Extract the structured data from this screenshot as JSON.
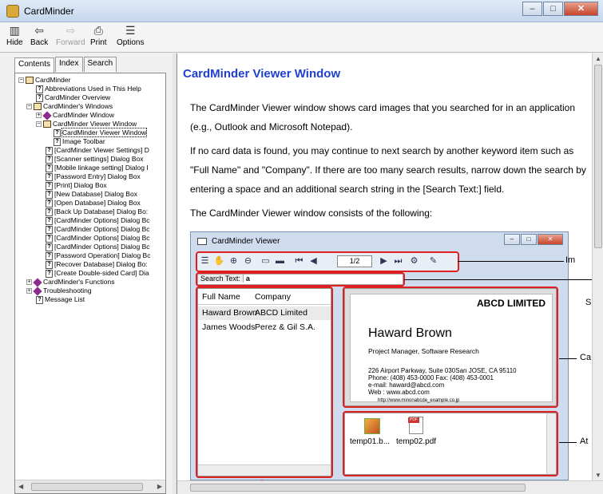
{
  "window": {
    "title": "CardMinder",
    "min": "–",
    "max": "□",
    "close": "✕"
  },
  "toolbar": {
    "hide": "Hide",
    "back": "Back",
    "forward": "Forward",
    "print": "Print",
    "options": "Options"
  },
  "tabs": [
    "Contents",
    "Index",
    "Search"
  ],
  "tree": {
    "items": [
      "CardMinder",
      "Abbreviations Used in This Help",
      "CardMinder Overview",
      "CardMinder's Windows",
      "CardMinder Window",
      "CardMinder Viewer Window",
      "CardMinder Viewer Window",
      "Image Toolbar",
      "[CardMinder Viewer Settings] D",
      "[Scanner settings] Dialog Box",
      "[Mobile linkage setting] Dialog I",
      "[Password Entry] Dialog Box",
      "[Print] Dialog Box",
      "[New Database] Dialog Box",
      "[Open Database] Dialog Box",
      "[Back Up Database] Dialog Bo:",
      "[CardMinder Options] Dialog Bc",
      "[CardMinder Options] Dialog Bc",
      "[CardMinder Options] Dialog Bc",
      "[CardMinder Options] Dialog Bc",
      "[Password Operation] Dialog Bc",
      "[Recover Database] Dialog Bo:",
      "[Create Double-sided Card] Dia",
      "CardMinder's Functions",
      "Troubleshooting",
      "Message List"
    ]
  },
  "content": {
    "heading": "CardMinder Viewer Window",
    "p1": "The CardMinder Viewer window shows card images that you searched for in an application (e.g., Outlook and Microsoft Notepad).",
    "p2": "If no card data is found, you may continue to next search by another keyword item such as \"Full Name\" and \"Company\". If there are too many search results, narrow down the search by entering a space and an additional search string in the [Search Text:] field.",
    "p3": "The CardMinder Viewer window consists of the following:"
  },
  "figure": {
    "title": "CardMinder Viewer",
    "page": "1/2",
    "search_label": "Search Text:",
    "search_value": "a",
    "list_header": [
      "Full Name",
      "Company"
    ],
    "rows": [
      [
        "Haward Brown",
        "ABCD Limited"
      ],
      [
        "James Woods",
        "Perez & Gil S.A."
      ]
    ],
    "card": {
      "company": "ABCD LIMITED",
      "name": "Haward Brown",
      "title": "Project Manager, Software Research",
      "addr1": "226 Airport Parkway, Suite 030San JOSE, CA 95110",
      "addr2": "Phone: (408) 453-0000     Fax: (408) 453-0001",
      "addr3": "e-mail: haward@abcd.com",
      "addr4": "Web  : www.abcd.com",
      "url": "http://www.minonabcde_example.co.jp"
    },
    "attachments": [
      "temp01.b...",
      "temp02.pdf"
    ],
    "pdf_badge": "PDF",
    "callouts": [
      "Im",
      "S",
      "Ca",
      "At"
    ]
  }
}
